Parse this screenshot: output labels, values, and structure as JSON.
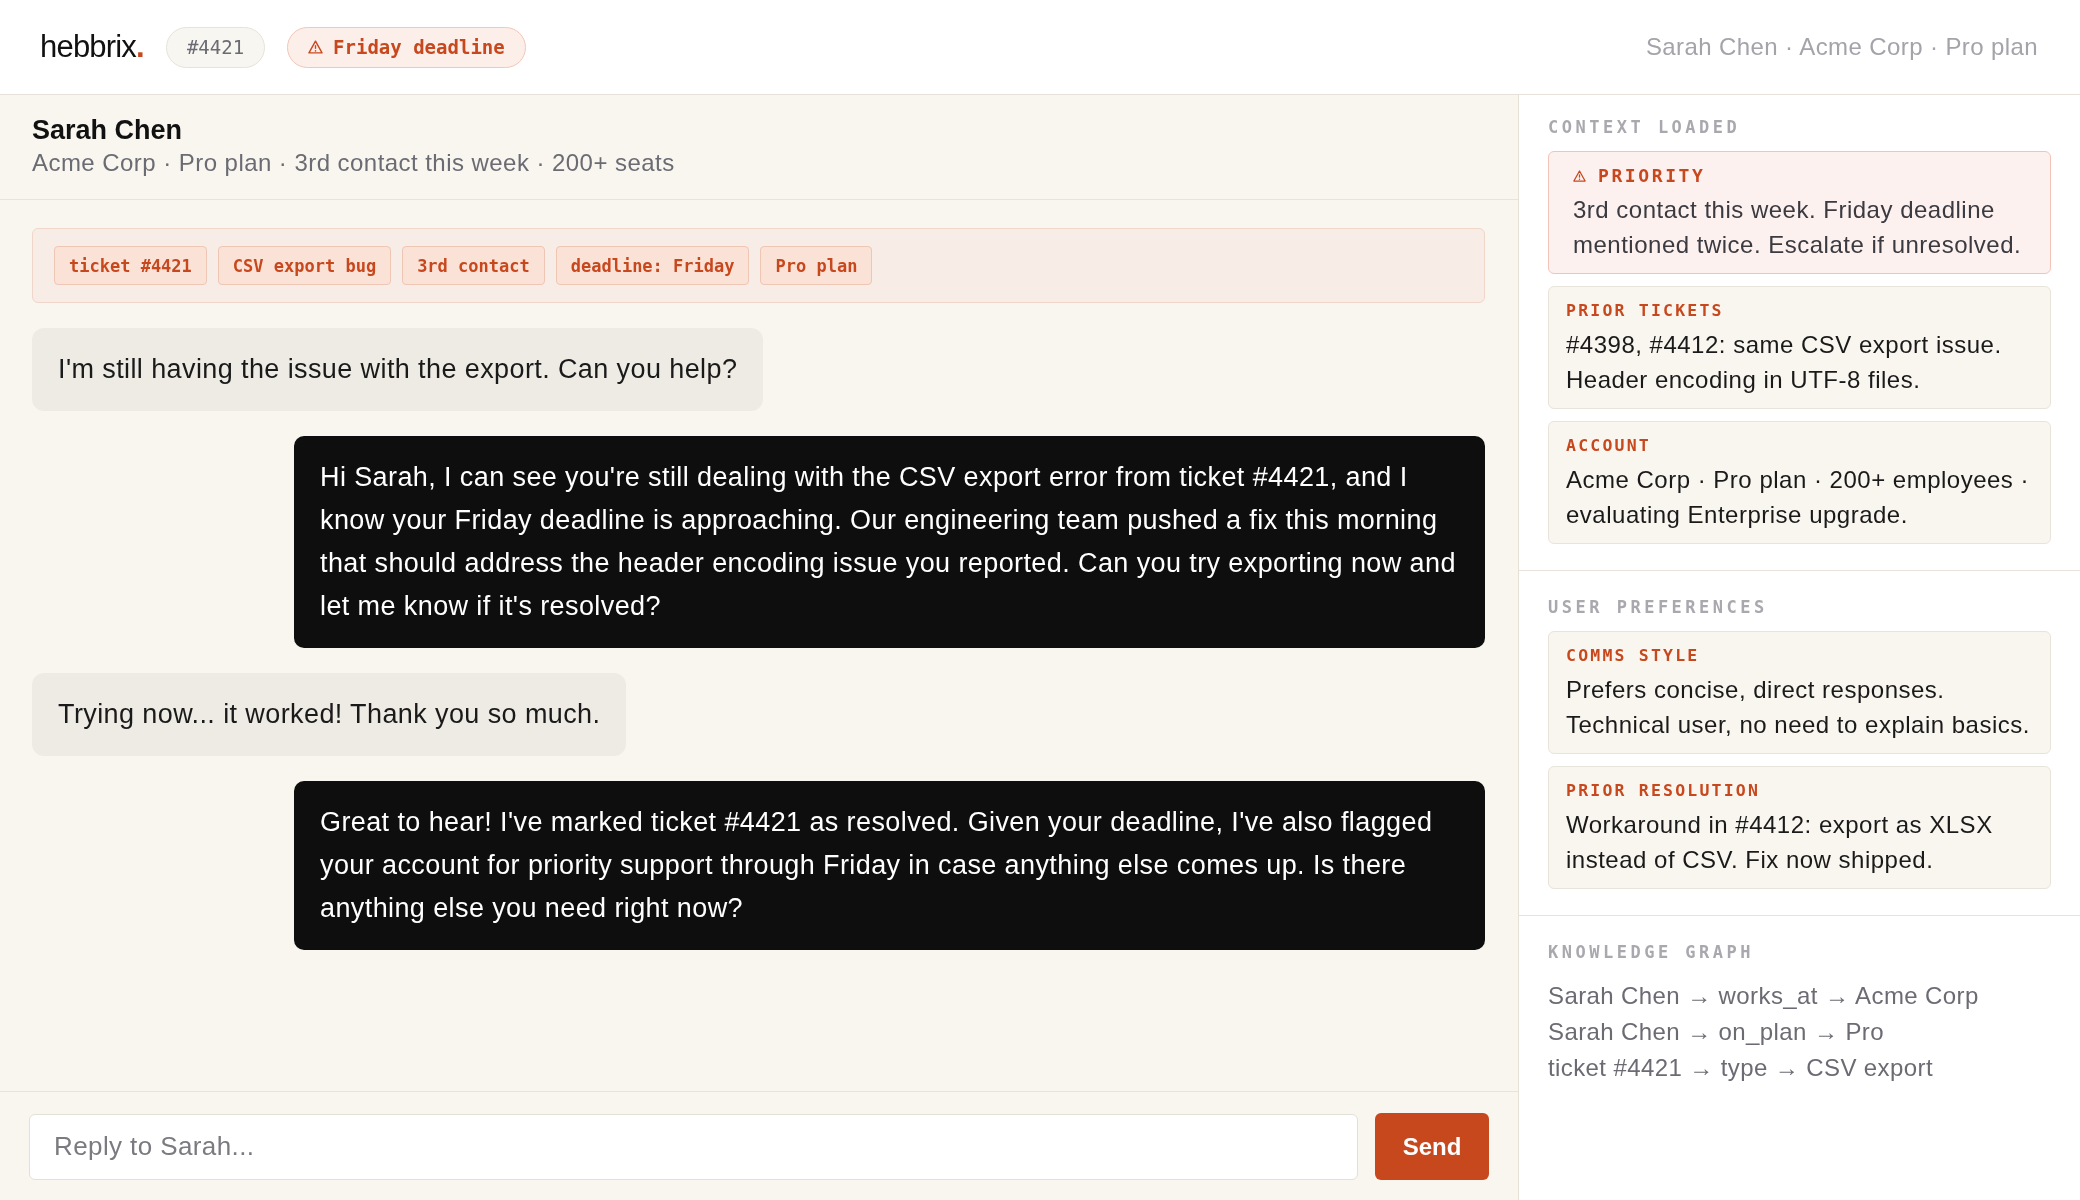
{
  "top_bar": {
    "logo": {
      "name": "hebbrix",
      "mark": "."
    },
    "ticket_badge": "#4421",
    "deadline_badge": "Friday deadline",
    "customer_summary": "Sarah Chen · Acme Corp · Pro plan"
  },
  "conversation": {
    "customer_name": "Sarah Chen",
    "customer_details": "Acme Corp · Pro plan · 3rd contact this week · 200+ seats",
    "tags": [
      "ticket #4421",
      "CSV export bug",
      "3rd contact",
      "deadline: Friday",
      "Pro plan"
    ],
    "messages": [
      {
        "kind": "incoming",
        "text": "I'm still having the issue with the export. Can you help?"
      },
      {
        "kind": "outgoing",
        "text": "Hi Sarah, I can see you're still dealing with the CSV export error from ticket #4421, and I know your Friday deadline is approaching. Our engineering team pushed a fix this morning that should address the header encoding issue you reported. Can you try exporting now and let me know if it's resolved?"
      },
      {
        "kind": "incoming",
        "text": "Trying now... it worked! Thank you so much."
      },
      {
        "kind": "outgoing",
        "text": "Great to hear! I've marked ticket #4421 as resolved. Given your deadline, I've also flagged your account for priority support through Friday in case anything else comes up. Is there anything else you need right now?"
      }
    ],
    "reply": {
      "placeholder": "Reply to Sarah...",
      "send_label": "Send"
    }
  },
  "sidebar": {
    "sections": [
      {
        "kind": "cards",
        "title": "CONTEXT LOADED",
        "cards": [
          {
            "kind": "alert",
            "label": "PRIORITY",
            "text": "3rd contact this week. Friday deadline mentioned twice. Escalate if unresolved."
          },
          {
            "kind": "note",
            "label": "PRIOR TICKETS",
            "text": "#4398, #4412: same CSV export issue. Header encoding in UTF-8 files."
          },
          {
            "kind": "note",
            "label": "ACCOUNT",
            "text": "Acme Corp · Pro plan · 200+ employees · evaluating Enterprise upgrade."
          }
        ]
      },
      {
        "kind": "cards",
        "title": "USER PREFERENCES",
        "cards": [
          {
            "kind": "note",
            "label": "COMMS STYLE",
            "text": "Prefers concise, direct responses. Technical user, no need to explain basics."
          },
          {
            "kind": "note",
            "label": "PRIOR RESOLUTION",
            "text": "Workaround in #4412: export as XLSX instead of CSV. Fix now shipped."
          }
        ]
      },
      {
        "kind": "graph",
        "title": "KNOWLEDGE GRAPH",
        "triples": [
          "Sarah Chen → works_at → Acme Corp",
          "Sarah Chen → on_plan → Pro",
          "ticket #4421 → type → CSV export"
        ]
      }
    ]
  }
}
